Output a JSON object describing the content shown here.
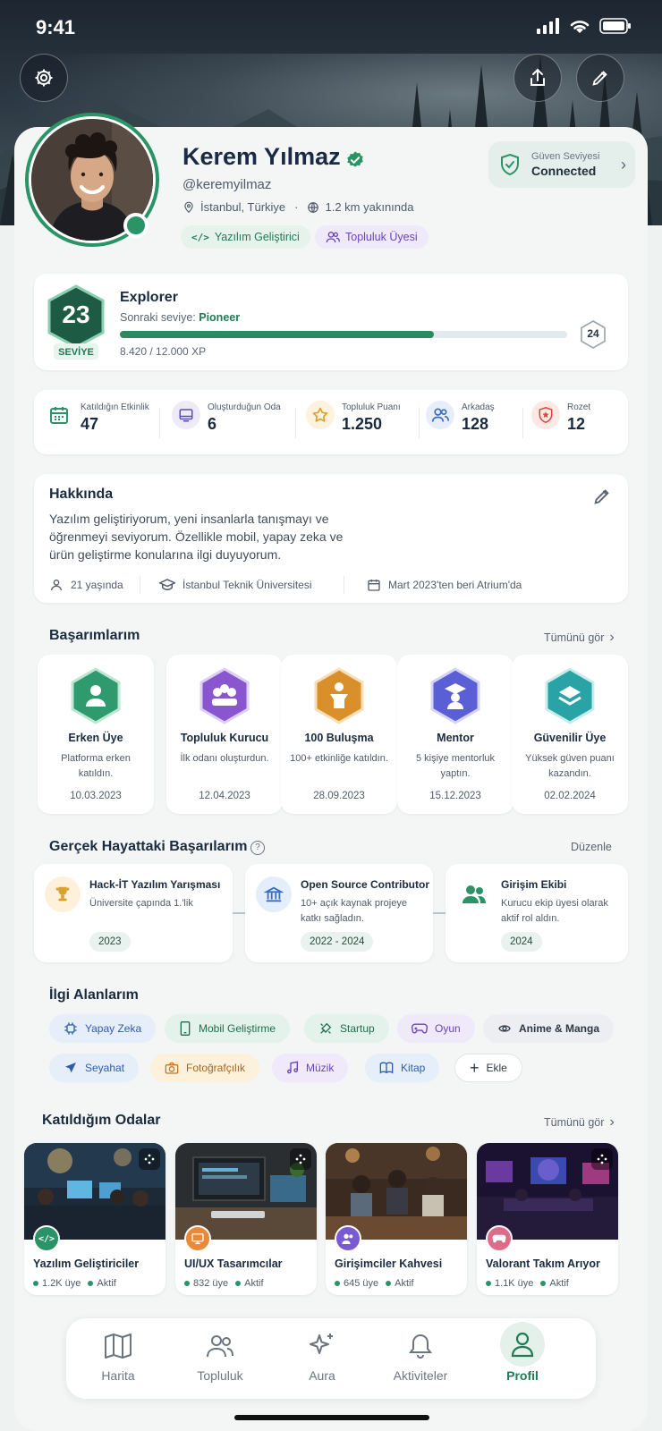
{
  "status": {
    "time": "9:41"
  },
  "profile": {
    "name": "Kerem Yılmaz",
    "handle": "@keremyilmaz",
    "location": "İstanbul, Türkiye",
    "distance": "1.2 km yakınında",
    "chips": [
      "Yazılım Geliştirici",
      "Topluluk Üyesi"
    ]
  },
  "trust": {
    "label": "Güven Seviyesi",
    "value": "Connected"
  },
  "level": {
    "number": "23",
    "caption": "SEVİYE",
    "title": "Explorer",
    "next_prefix": "Sonraki seviye: ",
    "next_name": "Pioneer",
    "xp": "8.420 / 12.000 XP",
    "progress_fraction": 0.702,
    "next_number": "24"
  },
  "stats": [
    {
      "label": "Katıldığın Etkinlik",
      "value": "47",
      "icon": "calendar-icon"
    },
    {
      "label": "Oluşturduğun Oda",
      "value": "6",
      "icon": "room-icon"
    },
    {
      "label": "Topluluk Puanı",
      "value": "1.250",
      "icon": "star-icon"
    },
    {
      "label": "Arkadaş",
      "value": "128",
      "icon": "friends-icon"
    },
    {
      "label": "Rozet",
      "value": "12",
      "icon": "badge-icon"
    }
  ],
  "about": {
    "title": "Hakkında",
    "text": "Yazılım geliştiriyorum, yeni insanlarla tanışmayı ve öğrenmeyi seviyorum. Özellikle mobil, yapay zeka ve ürün geliştirme konularına ilgi duyuyorum.",
    "age": "21 yaşında",
    "school": "İstanbul Teknik Üniversitesi",
    "since": "Mart 2023'ten beri Atrium'da"
  },
  "achievements": {
    "title": "Başarımlarım",
    "see_all": "Tümünü gör",
    "items": [
      {
        "title": "Erken Üye",
        "desc": "Platforma erken katıldın.",
        "date": "10.03.2023",
        "color": "#2f9a6e"
      },
      {
        "title": "Topluluk Kurucu",
        "desc": "İlk odanı oluşturdun.",
        "date": "12.04.2023",
        "color": "#8a56cf"
      },
      {
        "title": "100 Buluşma",
        "desc": "100+ etkinliğe katıldın.",
        "date": "28.09.2023",
        "color": "#d9902a"
      },
      {
        "title": "Mentor",
        "desc": "5 kişiye mentorluk yaptın.",
        "date": "15.12.2023",
        "color": "#5b5fd6"
      },
      {
        "title": "Güvenilir Üye",
        "desc": "Yüksek güven puanı kazandın.",
        "date": "02.02.2024",
        "color": "#29a3a6"
      }
    ]
  },
  "real_life": {
    "title": "Gerçek Hayattaki Başarılarım",
    "edit": "Düzenle",
    "items": [
      {
        "title": "Hack-İT Yazılım Yarışması",
        "desc": "Üniversite çapında 1.'lik",
        "year": "2023",
        "icon": "trophy-icon"
      },
      {
        "title": "Open Source Contributor",
        "desc": "10+ açık kaynak projeye katkı sağladın.",
        "year": "2022 - 2024",
        "icon": "bank-icon"
      },
      {
        "title": "Girişim Ekibi",
        "desc": "Kurucu ekip üyesi olarak aktif rol aldın.",
        "year": "2024",
        "icon": "team-icon"
      }
    ]
  },
  "interests": {
    "title": "İlgi Alanlarım",
    "items": [
      {
        "label": "Yapay Zeka",
        "icon": "ai-icon"
      },
      {
        "label": "Mobil Geliştirme",
        "icon": "mobile-icon"
      },
      {
        "label": "Startup",
        "icon": "startup-icon"
      },
      {
        "label": "Oyun",
        "icon": "gamepad-icon"
      },
      {
        "label": "Anime & Manga",
        "icon": "anime-icon"
      },
      {
        "label": "Seyahat",
        "icon": "plane-icon"
      },
      {
        "label": "Fotoğrafçılık",
        "icon": "camera-icon"
      },
      {
        "label": "Müzik",
        "icon": "music-icon"
      },
      {
        "label": "Kitap",
        "icon": "book-icon"
      },
      {
        "label": "Ekle",
        "icon": "plus-icon"
      }
    ]
  },
  "rooms": {
    "title": "Katıldığım Odalar",
    "see_all": "Tümünü gör",
    "items": [
      {
        "title": "Yazılım Geliştiriciler",
        "members": "1.2K üye",
        "status": "Aktif"
      },
      {
        "title": "UI/UX Tasarımcılar",
        "members": "832 üye",
        "status": "Aktif"
      },
      {
        "title": "Girişimciler Kahvesi",
        "members": "645 üye",
        "status": "Aktif"
      },
      {
        "title": "Valorant Takım Arıyor",
        "members": "1.1K üye",
        "status": "Aktif"
      }
    ]
  },
  "nav": [
    {
      "label": "Harita",
      "icon": "map-icon"
    },
    {
      "label": "Topluluk",
      "icon": "community-icon"
    },
    {
      "label": "Aura",
      "icon": "sparkle-icon"
    },
    {
      "label": "Aktiviteler",
      "icon": "bell-icon"
    },
    {
      "label": "Profil",
      "icon": "profile-icon"
    }
  ]
}
